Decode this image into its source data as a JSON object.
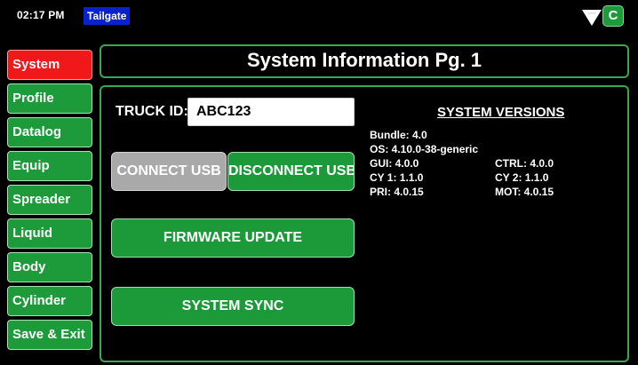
{
  "statusbar": {
    "time": "02:17 PM",
    "mode": "Tailgate",
    "connection_label": "C",
    "icons": {
      "signal": "signal-triangle-icon",
      "connection": "connection-badge-icon"
    }
  },
  "sidebar": {
    "items": [
      {
        "label": "System",
        "active": true
      },
      {
        "label": "Profile",
        "active": false
      },
      {
        "label": "Datalog",
        "active": false
      },
      {
        "label": "Equip",
        "active": false
      },
      {
        "label": "Spreader",
        "active": false
      },
      {
        "label": "Liquid",
        "active": false
      },
      {
        "label": "Body",
        "active": false
      },
      {
        "label": "Cylinder",
        "active": false
      },
      {
        "label": "Save & Exit",
        "active": false
      }
    ]
  },
  "header": {
    "title": "System Information Pg. 1"
  },
  "main": {
    "truck_id_label": "TRUCK ID:",
    "truck_id_value": "ABC123",
    "connect_usb_label": "CONNECT USB",
    "disconnect_usb_label": "DISCONNECT USB",
    "firmware_update_label": "FIRMWARE UPDATE",
    "system_sync_label": "SYSTEM SYNC"
  },
  "versions": {
    "title": "SYSTEM VERSIONS",
    "bundle": "Bundle: 4.0",
    "os": "OS: 4.10.0-38-generic",
    "gui": "GUI: 4.0.0",
    "ctrl": "CTRL: 4.0.0",
    "cy1": "CY 1: 1.1.0",
    "cy2": "CY 2: 1.1.0",
    "pri": "PRI: 4.0.15",
    "mot": "MOT: 4.0.15"
  },
  "colors": {
    "active_nav": "#f01818",
    "nav": "#1d9a3a",
    "disabled_button": "#a9a9a9",
    "accent_border": "#39a84f",
    "mode_badge": "#0a22cc"
  }
}
